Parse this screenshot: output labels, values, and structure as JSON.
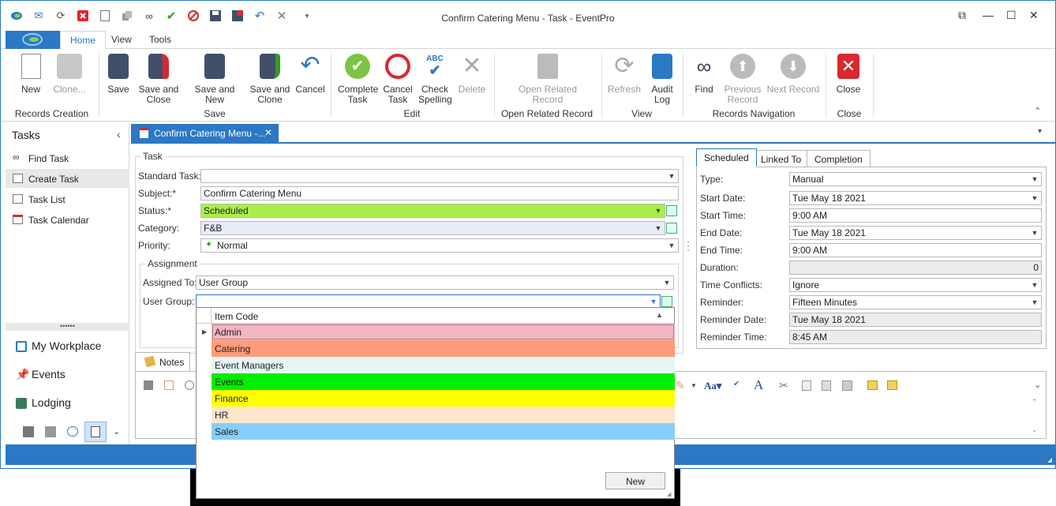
{
  "window": {
    "title": "Confirm Catering Menu - Task - EventPro"
  },
  "ribbon_tabs": [
    "Home",
    "View",
    "Tools"
  ],
  "ribbon": {
    "buttons": [
      {
        "label": "New",
        "enabled": true
      },
      {
        "label": "Clone...",
        "enabled": false
      },
      {
        "label": "Save",
        "enabled": true
      },
      {
        "label": "Save and Close",
        "enabled": true
      },
      {
        "label": "Save and New",
        "enabled": true
      },
      {
        "label": "Save and Clone",
        "enabled": true
      },
      {
        "label": "Cancel",
        "enabled": true
      },
      {
        "label": "Complete Task",
        "enabled": true
      },
      {
        "label": "Cancel Task",
        "enabled": true
      },
      {
        "label": "Check Spelling",
        "enabled": true
      },
      {
        "label": "Delete",
        "enabled": false
      },
      {
        "label": "Open Related Record",
        "enabled": false
      },
      {
        "label": "Refresh",
        "enabled": false
      },
      {
        "label": "Audit Log",
        "enabled": true
      },
      {
        "label": "Find",
        "enabled": true
      },
      {
        "label": "Previous Record",
        "enabled": false
      },
      {
        "label": "Next Record",
        "enabled": false
      },
      {
        "label": "Close",
        "enabled": true
      }
    ],
    "groups": [
      "Records Creation",
      "Save",
      "Edit",
      "Open Related Record",
      "View",
      "Records Navigation",
      "Close"
    ]
  },
  "sidebar": {
    "title": "Tasks",
    "items": [
      "Find Task",
      "Create Task",
      "Task List",
      "Task Calendar"
    ],
    "bottom": [
      "My Workplace",
      "Events",
      "Lodging"
    ]
  },
  "doc_tab": {
    "label": "Confirm Catering Menu -..."
  },
  "task": {
    "group_title": "Task",
    "standard_task_label": "Standard Task:",
    "standard_task_value": "",
    "subject_label": "Subject:*",
    "subject_value": "Confirm Catering Menu",
    "status_label": "Status:*",
    "status_value": "Scheduled",
    "category_label": "Category:",
    "category_value": "F&B",
    "priority_label": "Priority:",
    "priority_value": "Normal",
    "assignment_title": "Assignment",
    "assigned_to_label": "Assigned To:",
    "assigned_to_value": "User Group",
    "user_group_label": "User Group:",
    "user_group_value": ""
  },
  "notes_tab": {
    "label": "Notes"
  },
  "dropdown": {
    "header": "Item Code",
    "rows": [
      {
        "label": "Admin",
        "color": "#f4b6c2"
      },
      {
        "label": "Catering",
        "color": "#ff9c7a"
      },
      {
        "label": "Event Managers",
        "color": "#e4f6f6"
      },
      {
        "label": "Events",
        "color": "#00ee00"
      },
      {
        "label": "Finance",
        "color": "#ffff00"
      },
      {
        "label": "HR",
        "color": "#fde6cc"
      },
      {
        "label": "Sales",
        "color": "#87cefa"
      }
    ],
    "new_label": "New"
  },
  "schedule_tabs": [
    "Scheduled",
    "Linked To",
    "Completion"
  ],
  "schedule": {
    "type_label": "Type:",
    "type_value": "Manual",
    "start_date_label": "Start Date:",
    "start_date_value": "Tue May 18 2021",
    "start_time_label": "Start Time:",
    "start_time_value": "9:00 AM",
    "end_date_label": "End Date:",
    "end_date_value": "Tue May 18 2021",
    "end_time_label": "End Time:",
    "end_time_value": "9:00 AM",
    "duration_label": "Duration:",
    "duration_value": "0",
    "time_conflicts_label": "Time Conflicts:",
    "time_conflicts_value": "Ignore",
    "reminder_label": "Reminder:",
    "reminder_value": "Fifteen Minutes",
    "reminder_date_label": "Reminder Date:",
    "reminder_date_value": "Tue May 18 2021",
    "reminder_time_label": "Reminder Time:",
    "reminder_time_value": "8:45 AM"
  },
  "colors": {
    "accent": "#2b78c5",
    "status_green": "#a8f048",
    "category_bg": "#e6ecf8"
  }
}
